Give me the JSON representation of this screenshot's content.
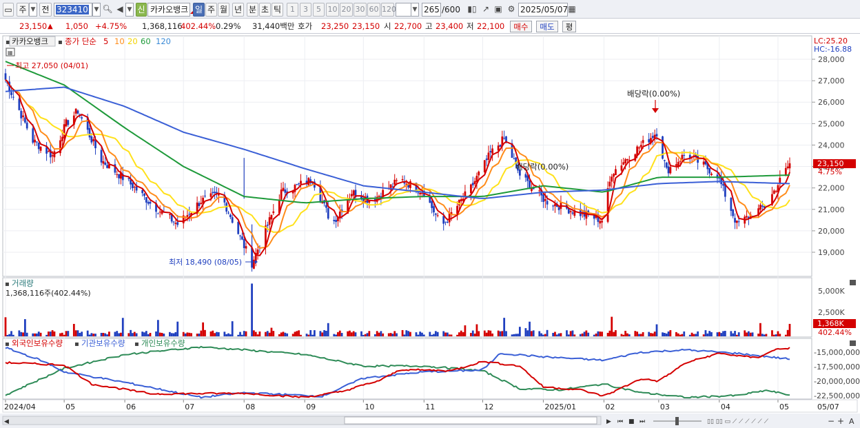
{
  "toolbar": {
    "market_type": "주",
    "prev_label": "전",
    "stock_code": "323410",
    "stock_name": "카카오뱅크",
    "credit_badge": "신",
    "period_tabs": [
      "일",
      "주",
      "월",
      "년",
      "분",
      "초",
      "틱"
    ],
    "active_period": "일",
    "interval_buttons": [
      "1",
      "3",
      "5",
      "10",
      "20",
      "30",
      "60",
      "120"
    ],
    "count_display": "265",
    "count_total": "/600",
    "date": "2025/05/07"
  },
  "quote": {
    "price": "23,150",
    "change": "1,050",
    "change_pct": "+4.75%",
    "volume": "1,368,116",
    "volume_ratio": "402.44%",
    "turnover": "0.29%",
    "amount": "31,440백만",
    "ask_label": "호가",
    "ask_price": "23,250",
    "bid_price": "23,150",
    "open_label": "시",
    "open": "22,700",
    "high_label": "고",
    "high": "23,400",
    "low_label": "저",
    "low": "22,100",
    "buy_label": "매수",
    "sell_label": "매도",
    "eval_label": "평"
  },
  "price_panel": {
    "stock_label": "카카오뱅크",
    "ma_prefix": "종가 단순",
    "ma_periods": [
      "5",
      "10",
      "20",
      "60",
      "120"
    ],
    "lc_label": "LC:25.20",
    "hc_label": "HC:-16.88",
    "high_annotation": "최고 27,050 (04/01)",
    "low_annotation": "최저 18,490 (08/05)",
    "dividend_1": "배당락(0.00%)",
    "dividend_2": "배당락(0.00%)",
    "price_ticks": [
      "28,000",
      "27,000",
      "26,000",
      "25,000",
      "24,000",
      "23,000",
      "22,000",
      "21,000",
      "20,000",
      "19,000"
    ],
    "last_price": "23,150",
    "last_pct": "4.75%"
  },
  "volume_panel": {
    "title": "거래량",
    "value": "1,368,116주(402.44%)",
    "ticks": [
      "5,000K",
      "2,500K"
    ],
    "last_value": "1,368K",
    "last_pct": "402.44%"
  },
  "holdings_panel": {
    "series": [
      "외국인보유수량",
      "기관보유수량",
      "개인보유수량"
    ],
    "ticks": [
      "-15,000,000",
      "-17,500,000",
      "-20,000,000",
      "-22,500,000"
    ]
  },
  "x_axis_labels": [
    "2024/04",
    "05",
    "06",
    "07",
    "08",
    "09",
    "10",
    "11",
    "12",
    "2025/01",
    "02",
    "03",
    "04",
    "05",
    "05/07"
  ],
  "colors": {
    "up": "#d40000",
    "down": "#1f3fbf",
    "ma5": "#d40000",
    "ma10": "#ff8c1a",
    "ma20": "#ffe11a",
    "ma60": "#1e9a3a",
    "ma120": "#3a5fd6",
    "foreign": "#d40000",
    "institution": "#3a5fd6",
    "individual": "#2e8b57"
  },
  "chart_data": {
    "type": "candlestick",
    "x_labels": [
      "2024/04",
      "05",
      "06",
      "07",
      "08",
      "09",
      "10",
      "11",
      "12",
      "2025/01",
      "02",
      "03",
      "04",
      "05"
    ],
    "price_range": [
      18000,
      28500
    ],
    "price_anchors": [
      [
        "2024/04/01",
        27050
      ],
      [
        "2024/04/15",
        24200
      ],
      [
        "2024/04/25",
        23500
      ],
      [
        "2024/05/02",
        25000
      ],
      [
        "2024/05/08",
        25600
      ],
      [
        "2024/05/20",
        23300
      ],
      [
        "2024/06/05",
        22100
      ],
      [
        "2024/06/15",
        21200
      ],
      [
        "2024/06/28",
        20300
      ],
      [
        "2024/07/10",
        21400
      ],
      [
        "2024/07/20",
        21700
      ],
      [
        "2024/08/05",
        18490
      ],
      [
        "2024/08/20",
        21800
      ],
      [
        "2024/09/05",
        22400
      ],
      [
        "2024/09/15",
        20300
      ],
      [
        "2024/09/25",
        21800
      ],
      [
        "2024/10/05",
        21400
      ],
      [
        "2024/10/20",
        22400
      ],
      [
        "2024/11/01",
        21800
      ],
      [
        "2024/11/10",
        20200
      ],
      [
        "2024/11/25",
        22000
      ],
      [
        "2024/12/05",
        23600
      ],
      [
        "2024/12/12",
        24300
      ],
      [
        "2024/12/20",
        22600
      ],
      [
        "2025/01/02",
        21400
      ],
      [
        "2025/01/20",
        20800
      ],
      [
        "2025/01/31",
        20500
      ],
      [
        "2025/02/05",
        22700
      ],
      [
        "2025/02/15",
        23600
      ],
      [
        "2025/02/28",
        24600
      ],
      [
        "2025/03/05",
        22800
      ],
      [
        "2025/03/15",
        23600
      ],
      [
        "2025/03/31",
        22600
      ],
      [
        "2025/04/10",
        20300
      ],
      [
        "2025/04/25",
        21200
      ],
      [
        "2025/05/07",
        23150
      ]
    ],
    "ma60_anchors": [
      [
        "2024/04/01",
        27900
      ],
      [
        "2024/05/01",
        26800
      ],
      [
        "2024/06/01",
        24800
      ],
      [
        "2024/07/01",
        23000
      ],
      [
        "2024/08/01",
        21600
      ],
      [
        "2024/09/01",
        21300
      ],
      [
        "2024/10/01",
        21500
      ],
      [
        "2024/11/01",
        21600
      ],
      [
        "2024/12/01",
        21600
      ],
      [
        "2025/01/01",
        22100
      ],
      [
        "2025/02/01",
        21800
      ],
      [
        "2025/03/01",
        22500
      ],
      [
        "2025/04/01",
        22500
      ],
      [
        "2025/05/07",
        22600
      ]
    ],
    "ma120_anchors": [
      [
        "2024/04/01",
        26500
      ],
      [
        "2024/05/01",
        26700
      ],
      [
        "2024/06/01",
        25800
      ],
      [
        "2024/07/01",
        24600
      ],
      [
        "2024/08/01",
        23800
      ],
      [
        "2024/09/01",
        22900
      ],
      [
        "2024/10/01",
        22100
      ],
      [
        "2024/11/01",
        21800
      ],
      [
        "2024/12/01",
        21500
      ],
      [
        "2025/01/01",
        21800
      ],
      [
        "2025/02/01",
        21900
      ],
      [
        "2025/03/01",
        22200
      ],
      [
        "2025/04/01",
        22300
      ],
      [
        "2025/05/07",
        22200
      ]
    ],
    "volume_max": 6500,
    "volume_spikes_k": [
      [
        "2024/08/05",
        5800
      ],
      [
        "2024/12/12",
        3200
      ],
      [
        "2025/02/05",
        2800
      ],
      [
        "2025/05/07",
        1368
      ]
    ],
    "holdings_range": [
      -23500000,
      -13500000
    ],
    "foreign_anchors": [
      [
        "2024/04/01",
        -16800000
      ],
      [
        "2024/05/01",
        -17200000
      ],
      [
        "2024/05/15",
        -20500000
      ],
      [
        "2024/06/15",
        -22200000
      ],
      [
        "2024/08/01",
        -22100000
      ],
      [
        "2024/09/01",
        -22800000
      ],
      [
        "2024/09/20",
        -21800000
      ],
      [
        "2024/10/10",
        -19800000
      ],
      [
        "2024/10/20",
        -18000000
      ],
      [
        "2024/11/15",
        -18200000
      ],
      [
        "2024/12/01",
        -16600000
      ],
      [
        "2024/12/20",
        -17400000
      ],
      [
        "2025/01/01",
        -21000000
      ],
      [
        "2025/01/20",
        -21500000
      ],
      [
        "2025/02/01",
        -22600000
      ],
      [
        "2025/02/20",
        -19600000
      ],
      [
        "2025/03/01",
        -20000000
      ],
      [
        "2025/03/15",
        -16800000
      ],
      [
        "2025/04/01",
        -15200000
      ],
      [
        "2025/04/20",
        -16000000
      ],
      [
        "2025/05/01",
        -14400000
      ],
      [
        "2025/05/07",
        -14300000
      ]
    ],
    "institution_anchors": [
      [
        "2024/04/01",
        -14200000
      ],
      [
        "2024/04/20",
        -16500000
      ],
      [
        "2024/05/01",
        -18400000
      ],
      [
        "2024/06/01",
        -20200000
      ],
      [
        "2024/07/10",
        -22800000
      ],
      [
        "2024/08/01",
        -22000000
      ],
      [
        "2024/09/10",
        -22600000
      ],
      [
        "2024/10/01",
        -19500000
      ],
      [
        "2024/11/01",
        -18400000
      ],
      [
        "2024/12/01",
        -18100000
      ],
      [
        "2024/12/10",
        -15200000
      ],
      [
        "2025/01/01",
        -15800000
      ],
      [
        "2025/02/01",
        -16400000
      ],
      [
        "2025/02/20",
        -15000000
      ],
      [
        "2025/03/15",
        -14600000
      ],
      [
        "2025/04/10",
        -15200000
      ],
      [
        "2025/05/07",
        -16200000
      ]
    ],
    "individual_anchors": [
      [
        "2024/04/01",
        -22400000
      ],
      [
        "2024/05/01",
        -17800000
      ],
      [
        "2024/06/01",
        -15400000
      ],
      [
        "2024/07/10",
        -14100000
      ],
      [
        "2024/08/01",
        -14600000
      ],
      [
        "2024/09/01",
        -15400000
      ],
      [
        "2024/10/01",
        -17400000
      ],
      [
        "2024/11/01",
        -17400000
      ],
      [
        "2024/12/01",
        -18200000
      ],
      [
        "2024/12/20",
        -21300000
      ],
      [
        "2025/01/10",
        -21500000
      ],
      [
        "2025/02/01",
        -20500000
      ],
      [
        "2025/02/20",
        -22000000
      ],
      [
        "2025/03/15",
        -22800000
      ],
      [
        "2025/04/10",
        -22500000
      ],
      [
        "2025/04/25",
        -21600000
      ],
      [
        "2025/05/07",
        -22400000
      ]
    ]
  }
}
